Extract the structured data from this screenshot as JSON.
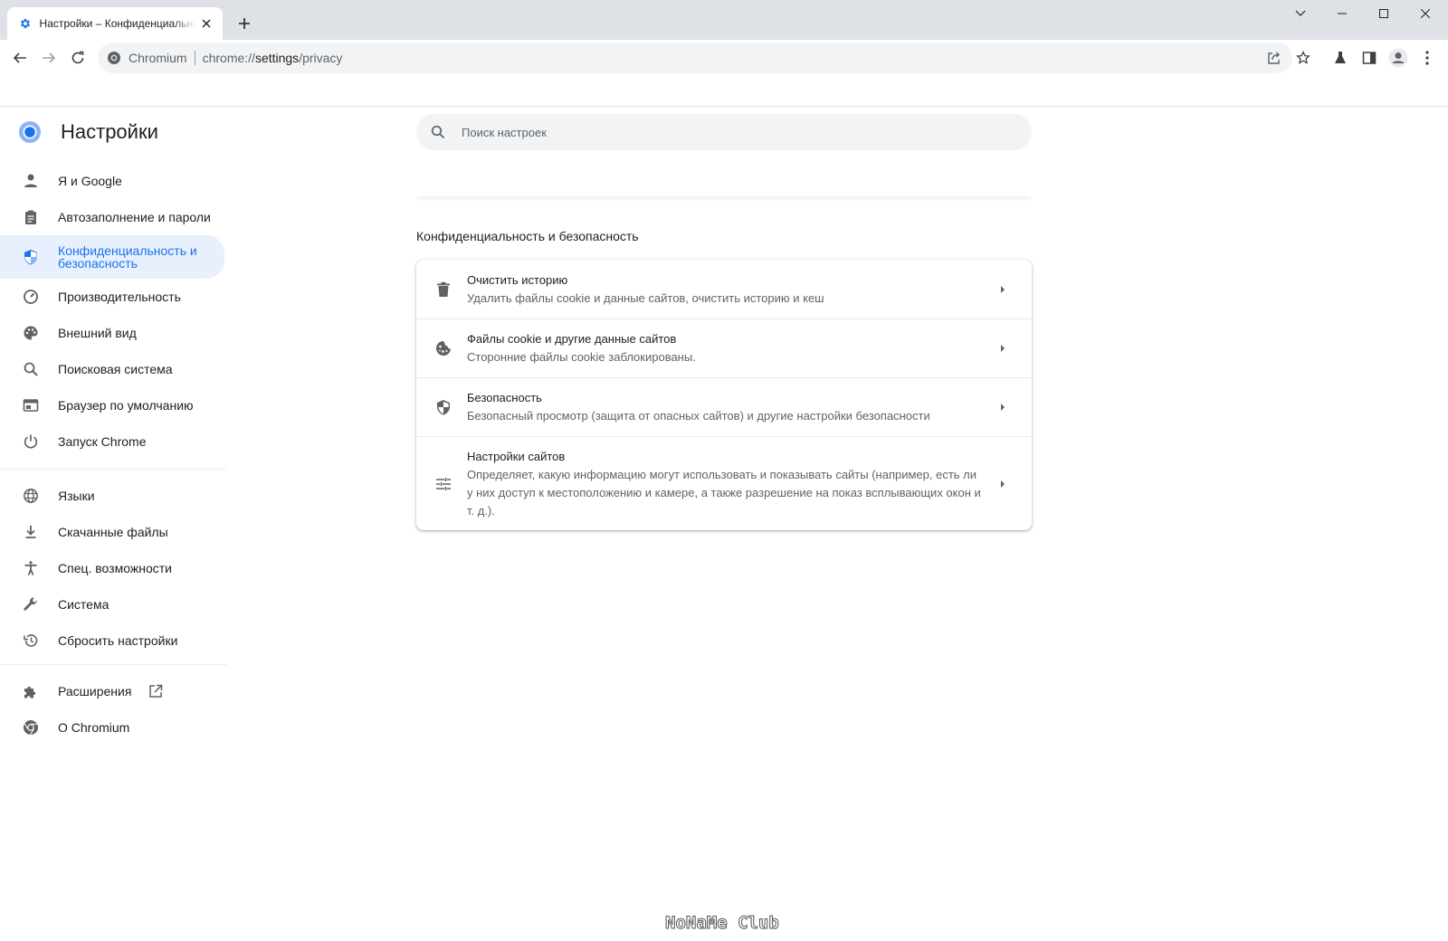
{
  "tab": {
    "title": "Настройки – Конфиденциальность и безопасность",
    "icon": "gear-icon"
  },
  "window_controls": [
    "chevron-down-icon",
    "minimize-icon",
    "maximize-icon",
    "close-icon"
  ],
  "toolbar": {
    "site_name": "Chromium",
    "url_scheme": "chrome://",
    "url_host": "settings",
    "url_path": "/privacy",
    "icons": [
      "back-icon",
      "forward-icon",
      "reload-icon",
      "share-icon",
      "bookmark-star-icon",
      "labs-flask-icon",
      "side-panel-icon",
      "profile-avatar-icon",
      "more-menu-icon"
    ]
  },
  "settings": {
    "title": "Настройки",
    "search_placeholder": "Поиск настроек"
  },
  "sidebar": {
    "items": [
      {
        "label": "Я и Google",
        "icon": "person-icon"
      },
      {
        "label": "Автозаполнение и пароли",
        "icon": "clipboard-icon"
      },
      {
        "label": "Конфиденциальность и безопасность",
        "icon": "shield-icon",
        "active": true
      },
      {
        "label": "Производительность",
        "icon": "speedometer-icon"
      },
      {
        "label": "Внешний вид",
        "icon": "palette-icon"
      },
      {
        "label": "Поисковая система",
        "icon": "search-icon"
      },
      {
        "label": "Браузер по умолчанию",
        "icon": "browser-window-icon"
      },
      {
        "label": "Запуск Chrome",
        "icon": "power-icon"
      },
      {
        "label": "Языки",
        "icon": "globe-icon"
      },
      {
        "label": "Скачанные файлы",
        "icon": "download-icon"
      },
      {
        "label": "Спец. возможности",
        "icon": "accessibility-icon"
      },
      {
        "label": "Система",
        "icon": "wrench-icon"
      },
      {
        "label": "Сбросить настройки",
        "icon": "restore-history-icon"
      },
      {
        "label": "Расширения",
        "icon": "puzzle-icon"
      },
      {
        "label": "О Chromium",
        "icon": "chromium-icon"
      }
    ]
  },
  "main": {
    "section_title": "Конфиденциальность и безопасность",
    "rows": [
      {
        "label": "Очистить историю",
        "sub": "Удалить файлы cookie и данные сайтов, очистить историю и кеш",
        "icon": "trash-icon"
      },
      {
        "label": "Файлы cookie и другие данные сайтов",
        "sub": "Сторонние файлы cookie заблокированы.",
        "icon": "cookie-icon"
      },
      {
        "label": "Безопасность",
        "sub": "Безопасный просмотр (защита от опасных сайтов) и другие настройки безопасности",
        "icon": "security-shield-icon"
      },
      {
        "label": "Настройки сайтов",
        "sub": "Определяет, какую информацию могут использовать и показывать сайты (например, есть ли у них доступ к местоположению и камере, а также разрешение на показ всплывающих окон и т. д.).",
        "icon": "tune-sliders-icon"
      }
    ]
  },
  "watermark": "NoNaMe Club",
  "colors": {
    "accent": "#1a73e8",
    "active_bg": "#e8f0fe",
    "tabstrip": "#dee1e6",
    "icon": "#5f6368"
  }
}
